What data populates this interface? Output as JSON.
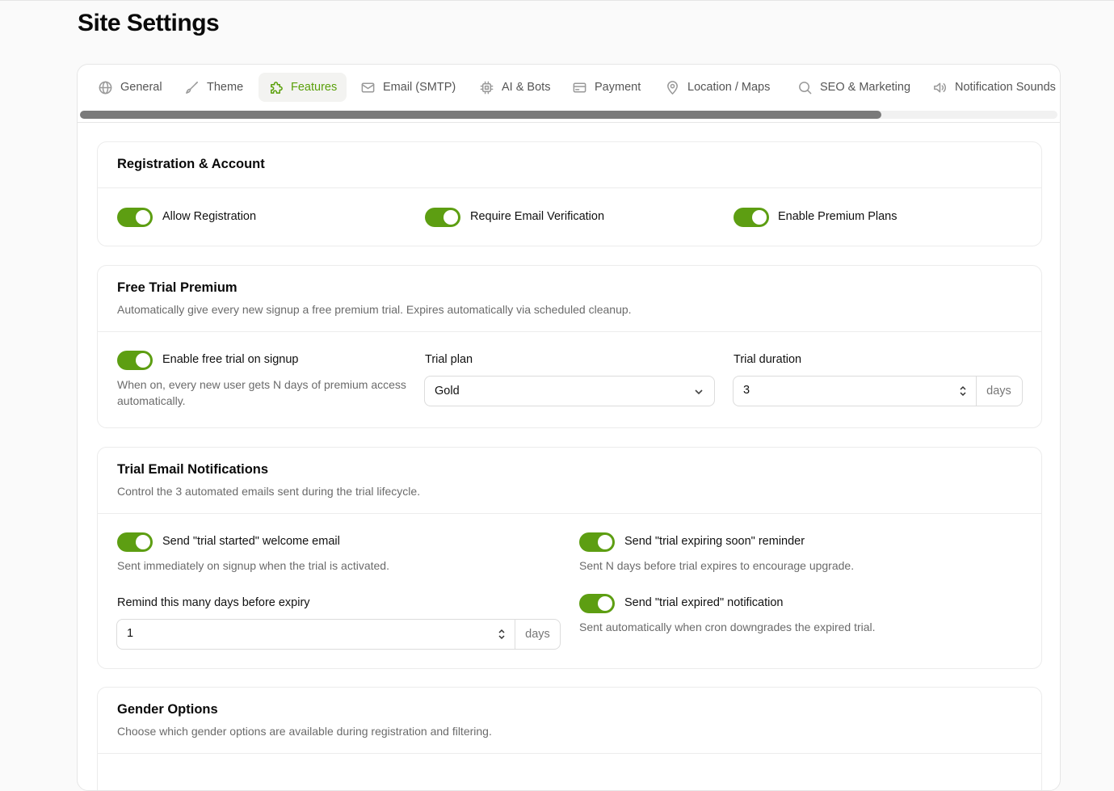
{
  "page": {
    "title": "Site Settings"
  },
  "tabs": [
    {
      "label": "General",
      "icon": "globe-icon"
    },
    {
      "label": "Theme",
      "icon": "brush-icon"
    },
    {
      "label": "Features",
      "icon": "puzzle-icon",
      "active": true
    },
    {
      "label": "Email (SMTP)",
      "icon": "mail-icon"
    },
    {
      "label": "AI & Bots",
      "icon": "chip-icon"
    },
    {
      "label": "Payment",
      "icon": "credit-card-icon"
    },
    {
      "label": "Location / Maps",
      "icon": "map-pin-icon"
    },
    {
      "label": "SEO & Marketing",
      "icon": "search-icon"
    },
    {
      "label": "Notification Sounds",
      "icon": "speaker-icon"
    }
  ],
  "registration": {
    "title": "Registration & Account",
    "toggles": [
      {
        "label": "Allow Registration",
        "on": true
      },
      {
        "label": "Require Email Verification",
        "on": true
      },
      {
        "label": "Enable Premium Plans",
        "on": true
      }
    ]
  },
  "free_trial": {
    "title": "Free Trial Premium",
    "description": "Automatically give every new signup a free premium trial. Expires automatically via scheduled cleanup.",
    "toggle_label": "Enable free trial on signup",
    "toggle_on": true,
    "toggle_help": "When on, every new user gets N days of premium access automatically.",
    "plan_label": "Trial plan",
    "plan_value": "Gold",
    "duration_label": "Trial duration",
    "duration_value": "3",
    "duration_suffix": "days"
  },
  "trial_emails": {
    "title": "Trial Email Notifications",
    "description": "Control the 3 automated emails sent during the trial lifecycle.",
    "started_label": "Send \"trial started\" welcome email",
    "started_help": "Sent immediately on signup when the trial is activated.",
    "expiring_label": "Send \"trial expiring soon\" reminder",
    "expiring_help": "Sent N days before trial expires to encourage upgrade.",
    "expired_label": "Send \"trial expired\" notification",
    "expired_help": "Sent automatically when cron downgrades the expired trial.",
    "remind_label": "Remind this many days before expiry",
    "remind_value": "1",
    "remind_suffix": "days"
  },
  "gender": {
    "title": "Gender Options",
    "description": "Choose which gender options are available during registration and filtering."
  },
  "colors": {
    "accent": "#5d9e12",
    "active_tab_text": "#5aa00a"
  }
}
